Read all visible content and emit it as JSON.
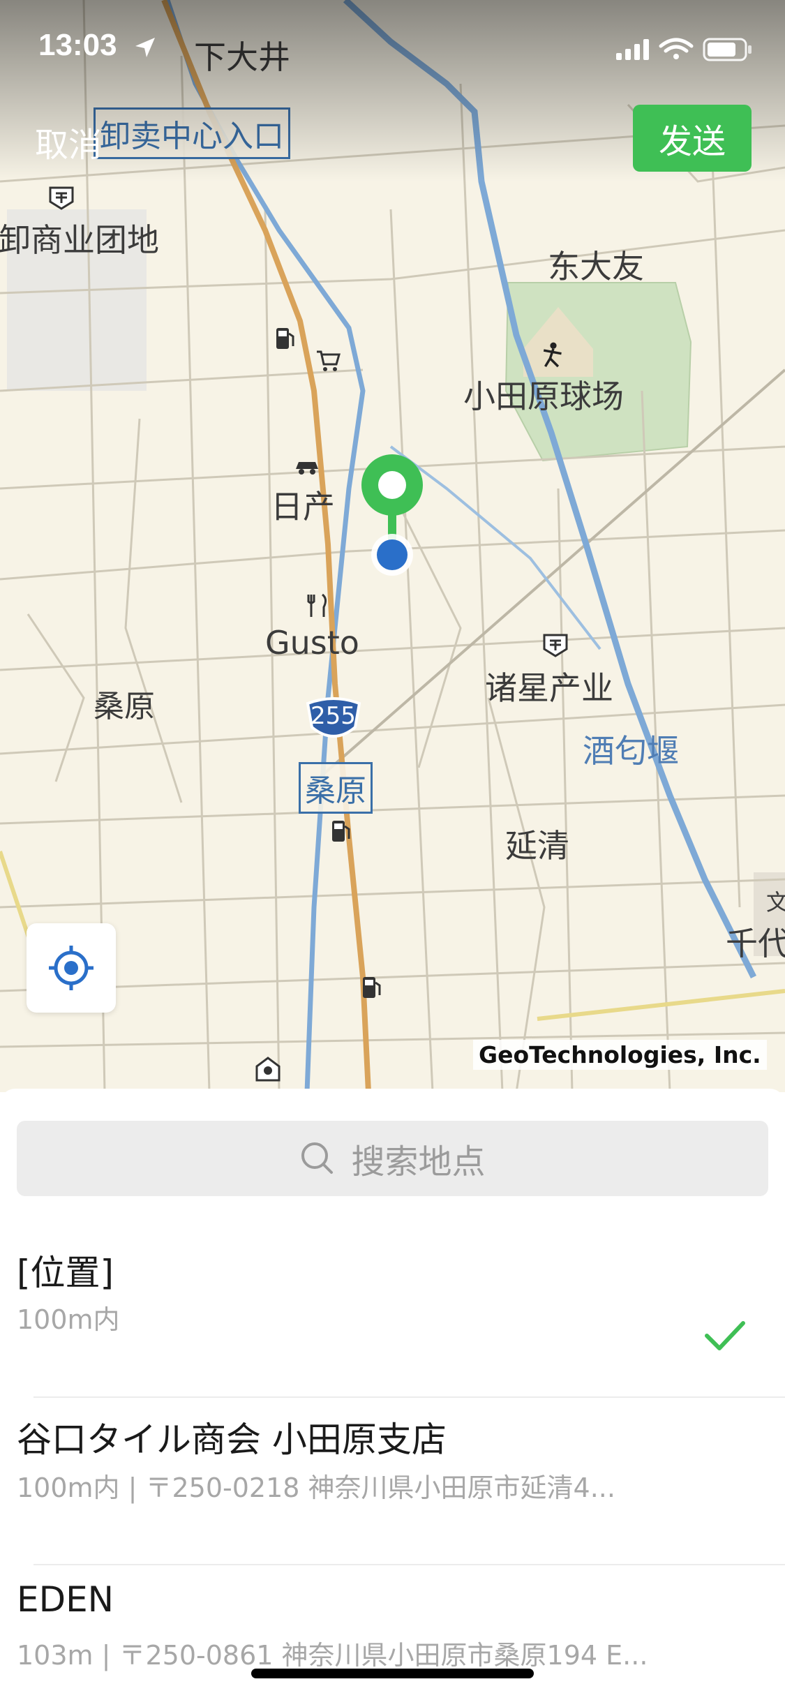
{
  "status_bar": {
    "time": "13:03"
  },
  "header": {
    "cancel_label": "取消",
    "send_label": "发送"
  },
  "map": {
    "labels": {
      "shimo_oi": "下大井",
      "wholesale_entrance": "卸卖中心入口",
      "commercial_estate": "卸商业团地",
      "higashi_otomo": "东大友",
      "stadium": "小田原球场",
      "nissan": "日产",
      "gusto": "Gusto",
      "kuwahara_left": "桑原",
      "shoseisangyo": "诸星产业",
      "sakawa_weir": "酒匂堰",
      "route": "255",
      "kuwahara_station": "桑原",
      "enkiyo": "延清",
      "chiyo": "千代",
      "chiyo_symbol": "文",
      "copyright": "GeoTechnologies, Inc."
    }
  },
  "search": {
    "placeholder": "搜索地点"
  },
  "results": [
    {
      "title": "[位置]",
      "subtitle": "100m内",
      "selected": true
    },
    {
      "title": "谷口タイル商会 小田原支店",
      "subtitle": "100m内 | 〒250-0218 神奈川県小田原市延清4..."
    },
    {
      "title": "EDEN",
      "subtitle": "103m | 〒250-0861 神奈川県小田原市桑原194 E..."
    }
  ],
  "colors": {
    "accent_green": "#3fbf55",
    "location_blue": "#2a6fc9",
    "map_bg": "#f7f3e6"
  }
}
